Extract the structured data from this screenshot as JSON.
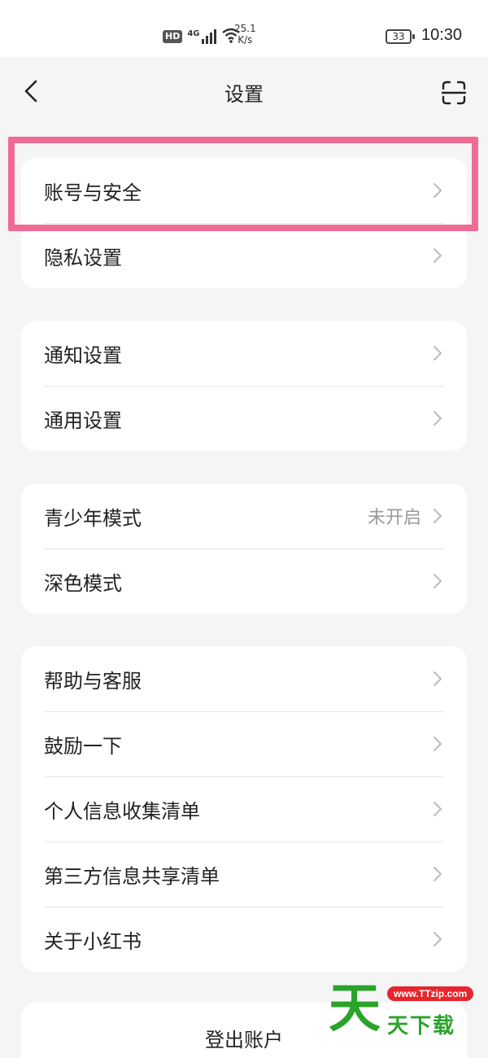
{
  "status_bar": {
    "hd": "HD",
    "signal": "4G",
    "net_speed_value": "25.1",
    "net_speed_unit": "K/s",
    "battery": "33",
    "time": "10:30"
  },
  "nav": {
    "title": "设置",
    "back_icon": "chevron-left-icon",
    "scan_icon": "scan-icon"
  },
  "groups": [
    {
      "items": [
        {
          "label": "账号与安全",
          "value": ""
        },
        {
          "label": "隐私设置",
          "value": ""
        }
      ]
    },
    {
      "items": [
        {
          "label": "通知设置",
          "value": ""
        },
        {
          "label": "通用设置",
          "value": ""
        }
      ]
    },
    {
      "items": [
        {
          "label": "青少年模式",
          "value": "未开启"
        },
        {
          "label": "深色模式",
          "value": ""
        }
      ]
    },
    {
      "items": [
        {
          "label": "帮助与客服",
          "value": ""
        },
        {
          "label": "鼓励一下",
          "value": ""
        },
        {
          "label": "个人信息收集清单",
          "value": ""
        },
        {
          "label": "第三方信息共享清单",
          "value": ""
        },
        {
          "label": "关于小红书",
          "value": ""
        }
      ]
    }
  ],
  "logout_label": "登出账户",
  "highlight_color": "#f06b94",
  "watermark": {
    "big_char": "天",
    "text": "天下载",
    "url": "www.TTzip.com"
  }
}
